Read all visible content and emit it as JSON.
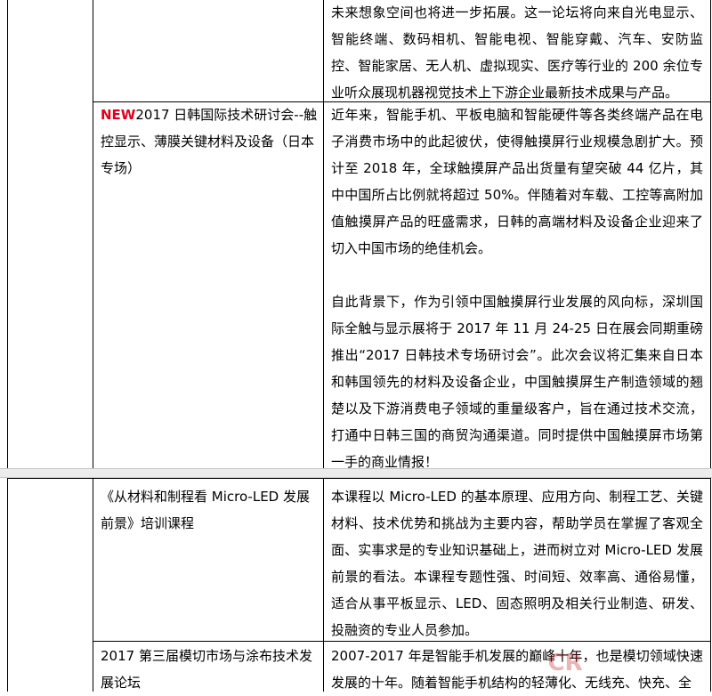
{
  "page_a": {
    "row_top": {
      "description": "未来想象空间也将进一步拓展。这一论坛将向来自光电显示、智能终端、数码相机、智能电视、智能穿戴、汽车、安防监控、智能家居、无人机、虚拟现实、医疗等行业的 200 余位专业听众展现机器视觉技术上下游企业最新技术成果与产品。"
    },
    "row_japan_korea": {
      "new_tag": "NEW",
      "title": "2017 日韩国际技术研讨会--触控显示、薄膜关键材料及设备（日本专场）",
      "paragraph_1": "近年来，智能手机、平板电脑和智能硬件等各类终端产品在电子消费市场中的此起彼伏，使得触摸屏行业规模急剧扩大。预计至 2018 年，全球触摸屏产品出货量有望突破 44 亿片，其中中国所占比例就将超过 50%。伴随着对车载、工控等高附加值触摸屏产品的旺盛需求，日韩的高端材料及设备企业迎来了切入中国市场的绝佳机会。",
      "paragraph_2": "自此背景下，作为引领中国触摸屏行业发展的风向标，深圳国际全触与显示展将于 2017 年 11 月 24-25 日在展会同期重磅推出“2017 日韩技术专场研讨会”。此次会议将汇集来自日本和韩国领先的材料及设备企业，中国触摸屏生产制造领域的翘楚以及下游消费电子领域的重量级客户，旨在通过技术交流，打通中日韩三国的商贸沟通渠道。同时提供中国触摸屏市场第一手的商业情报！"
    }
  },
  "page_b": {
    "row_micro_led": {
      "title": "《从材料和制程看 Micro-LED 发展前景》培训课程",
      "description": "本课程以 Micro-LED 的基本原理、应用方向、制程工艺、关键材料、技术优势和挑战为主要内容，帮助学员在掌握了客观全面、实事求是的专业知识基础上，进而树立对 Micro-LED 发展前景的看法。本课程专题性强、时间短、效率高、通俗易懂，适合从事平板显示、LED、固态照明及相关行业制造、研发、投融资的专业人员参加。"
    },
    "row_die_cut": {
      "title": "2017 第三届模切市场与涂布技术发展论坛",
      "description": "2007-2017 年是智能手机发展的巅峰十年，也是模切领域快速发展的十年。随着智能手机结构的轻薄化、无线充、快充、全"
    }
  },
  "watermark": {
    "text": "CR",
    "icon": "watermark-logo-icon"
  }
}
